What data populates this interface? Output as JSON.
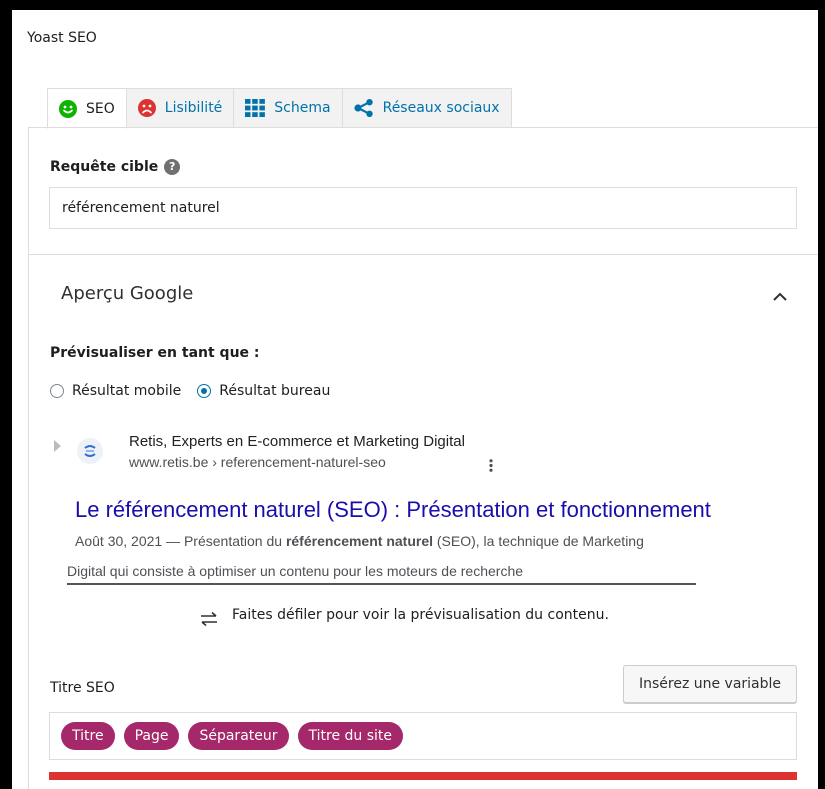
{
  "panel": {
    "title": "Yoast SEO"
  },
  "tabs": [
    {
      "label": "SEO",
      "icon": "smiley-happy-icon",
      "color": "#0fb200",
      "active": true
    },
    {
      "label": "Lisibilité",
      "icon": "smiley-sad-icon",
      "color": "#dc3232",
      "active": false
    },
    {
      "label": "Schema",
      "icon": "grid-icon",
      "color": "#0073aa",
      "active": false
    },
    {
      "label": "Réseaux sociaux",
      "icon": "share-icon",
      "color": "#0073aa",
      "active": false
    }
  ],
  "focus_keyphrase": {
    "label": "Requête cible",
    "help": "?",
    "value": "référencement naturel"
  },
  "google_preview": {
    "heading": "Aperçu Google",
    "preview_as_label": "Prévisualiser en tant que :",
    "options": [
      {
        "label": "Résultat mobile",
        "selected": false
      },
      {
        "label": "Résultat bureau",
        "selected": true
      }
    ],
    "serp": {
      "site_name": "Retis, Experts en E-commerce et Marketing Digital",
      "url": "www.retis.be › referencement-naturel-seo",
      "title": "Le référencement naturel (SEO) : Présentation et fonctionnement",
      "date": "Août 30, 2021",
      "desc_before": "Présentation du",
      "desc_bold": "référencement naturel",
      "desc_after": "(SEO), la technique de Marketing",
      "desc_line2": "Digital qui consiste à optimiser un contenu pour les moteurs de recherche"
    },
    "scroll_hint": "Faites défiler pour voir la prévisualisation du contenu."
  },
  "seo_title": {
    "label": "Titre SEO",
    "insert_variable_label": "Insérez une variable",
    "variables": [
      "Titre",
      "Page",
      "Séparateur",
      "Titre du site"
    ],
    "pill_color": "#a4286a",
    "progress_color": "#dc3232"
  }
}
